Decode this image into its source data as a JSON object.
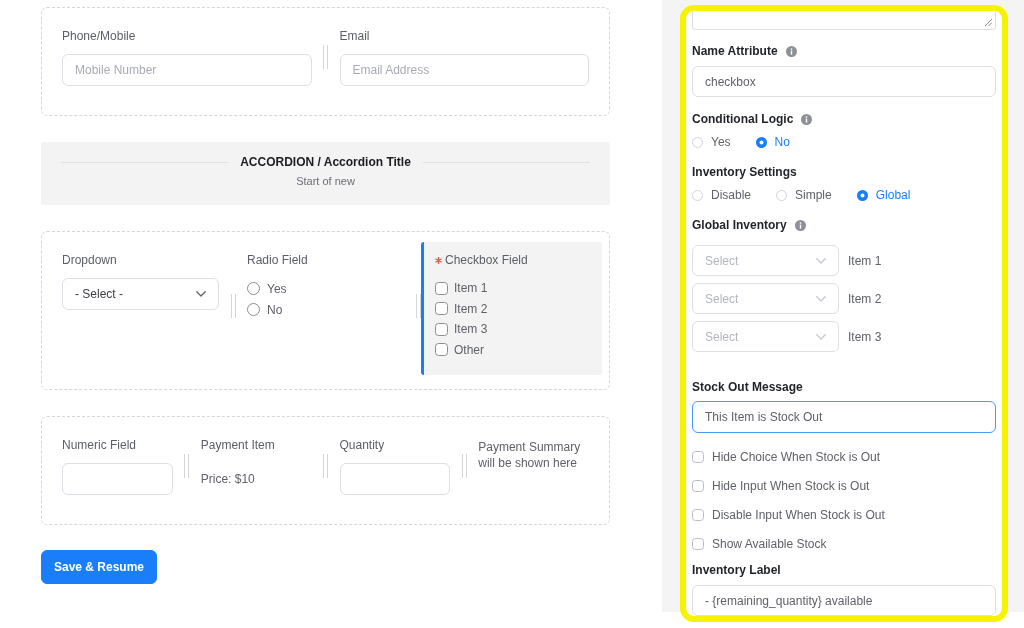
{
  "form_sections": [
    {
      "kind": "fields",
      "fields": [
        {
          "kind": "input",
          "label": "Phone/Mobile",
          "required": false,
          "selected": false,
          "placeholder": "Mobile Number"
        },
        {
          "kind": "input",
          "label": "Email",
          "required": false,
          "selected": false,
          "placeholder": "Email Address"
        }
      ]
    },
    {
      "kind": "accordion",
      "title": "ACCORDION / Accordion Title",
      "subtitle": "Start of new"
    },
    {
      "kind": "fields",
      "fields": [
        {
          "kind": "select",
          "label": "Dropdown",
          "required": false,
          "selected": false,
          "value": "- Select -"
        },
        {
          "kind": "radio",
          "label": "Radio Field",
          "required": false,
          "selected": false,
          "options": [
            {
              "label": "Yes",
              "selected": false
            },
            {
              "label": "No",
              "selected": false
            }
          ]
        },
        {
          "kind": "checkbox",
          "label": "Checkbox Field",
          "required": true,
          "selected": true,
          "options": [
            {
              "label": "Item 1",
              "checked": false
            },
            {
              "label": "Item 2",
              "checked": false
            },
            {
              "label": "Item 3",
              "checked": false
            },
            {
              "label": "Other",
              "checked": false
            }
          ]
        }
      ]
    },
    {
      "kind": "fields",
      "fields": [
        {
          "kind": "input",
          "label": "Numeric Field",
          "required": false,
          "selected": false
        },
        {
          "kind": "price",
          "label": "Payment Item",
          "required": false,
          "selected": false,
          "text": "Price: $10"
        },
        {
          "kind": "input",
          "label": "Quantity",
          "required": false,
          "selected": false
        },
        {
          "kind": "note",
          "selected": false,
          "text": "Payment Summary will be shown here"
        }
      ]
    }
  ],
  "save_button": "Save & Resume",
  "settings_panel": {
    "items": [
      {
        "kind": "textarea"
      },
      {
        "kind": "input",
        "label": "Name Attribute",
        "info": true,
        "value": "checkbox",
        "focused": false
      },
      {
        "kind": "radios",
        "label": "Conditional Logic",
        "info": true,
        "options": [
          {
            "label": "Yes",
            "selected": false
          },
          {
            "label": "No",
            "selected": true
          }
        ]
      },
      {
        "kind": "radios",
        "label": "Inventory Settings",
        "info": false,
        "options": [
          {
            "label": "Disable",
            "selected": false
          },
          {
            "label": "Simple",
            "selected": false
          },
          {
            "label": "Global",
            "selected": true
          }
        ]
      },
      {
        "kind": "selects",
        "label": "Global Inventory",
        "info": true,
        "rows": [
          {
            "placeholder": "Select",
            "item": "Item 1"
          },
          {
            "placeholder": "Select",
            "item": "Item 2"
          },
          {
            "placeholder": "Select",
            "item": "Item 3"
          }
        ]
      },
      {
        "kind": "input",
        "label": "Stock Out Message",
        "info": false,
        "value": "This Item is Stock Out",
        "focused": true
      },
      {
        "kind": "checkbox",
        "label": "Hide Choice When Stock is Out",
        "checked": false
      },
      {
        "kind": "checkbox",
        "label": "Hide Input When Stock is Out",
        "checked": false
      },
      {
        "kind": "checkbox",
        "label": "Disable Input When Stock is Out",
        "checked": false
      },
      {
        "kind": "checkbox",
        "label": "Show Available Stock",
        "checked": false
      },
      {
        "kind": "input",
        "label": "Inventory Label",
        "info": false,
        "value": "- {remaining_quantity} available",
        "focused": false
      }
    ]
  }
}
